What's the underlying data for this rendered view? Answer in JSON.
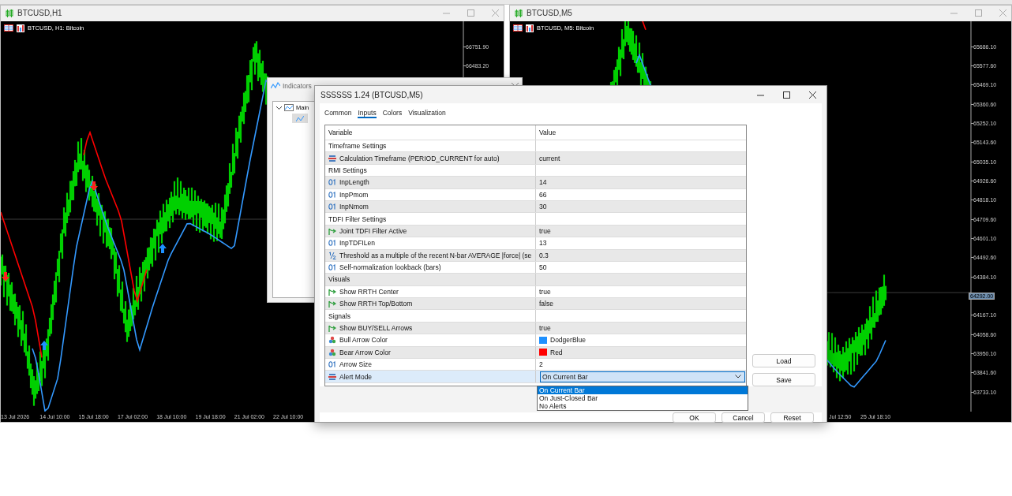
{
  "left_window": {
    "title": "BTCUSD,H1",
    "chart_label": "BTCUSD, H1:  Bitcoin",
    "price_axis": [
      {
        "kind": "tick",
        "label": "66751.90"
      },
      {
        "kind": "tick",
        "label": "66483.20"
      }
    ],
    "time_axis": [
      "13 Jul 2026",
      "14 Jul 10:00",
      "15 Jul 18:00",
      "17 Jul 02:00",
      "18 Jul 10:00",
      "19 Jul 18:00",
      "21 Jul 02:00",
      "22 Jul 10:00"
    ]
  },
  "right_window": {
    "title": "BTCUSD,M5",
    "chart_label": "BTCUSD, M5:  Bitcoin",
    "price_axis": [
      {
        "kind": "tick",
        "label": "65686.10"
      },
      {
        "kind": "tick",
        "label": "65577.60"
      },
      {
        "kind": "tick",
        "label": "65469.10"
      },
      {
        "kind": "tick",
        "label": "65360.60"
      },
      {
        "kind": "tick",
        "label": "65252.10"
      },
      {
        "kind": "tick",
        "label": "65143.60"
      },
      {
        "kind": "tick",
        "label": "65035.10"
      },
      {
        "kind": "tick",
        "label": "64926.60"
      },
      {
        "kind": "tick",
        "label": "64818.10"
      },
      {
        "kind": "tick",
        "label": "64709.60"
      },
      {
        "kind": "tick",
        "label": "64601.10"
      },
      {
        "kind": "tick",
        "label": "64492.60"
      },
      {
        "kind": "tick",
        "label": "64384.10"
      },
      {
        "kind": "current",
        "label": "64292.00"
      },
      {
        "kind": "tick",
        "label": "64167.10"
      },
      {
        "kind": "tick",
        "label": "64058.60"
      },
      {
        "kind": "tick",
        "label": "63950.10"
      },
      {
        "kind": "tick",
        "label": "63841.60"
      },
      {
        "kind": "tick",
        "label": "63733.10"
      }
    ],
    "time_axis": [
      "Jul 12:50",
      "25 Jul 18:10"
    ]
  },
  "indicators_window": {
    "title": "Indicators",
    "tree": [
      {
        "label": "Main",
        "expanded": true
      }
    ]
  },
  "dialog": {
    "title": "SSSSSS 1.24 (BTCUSD,M5)",
    "tabs": [
      {
        "label": "Common",
        "selected": false
      },
      {
        "label": "Inputs",
        "selected": true
      },
      {
        "label": "Colors",
        "selected": false
      },
      {
        "label": "Visualization",
        "selected": false
      }
    ],
    "columns": [
      "Variable",
      "Value"
    ],
    "rows": [
      {
        "kind": "group",
        "variable": "Timeframe Settings"
      },
      {
        "kind": "enum",
        "variable": "Calculation Timeframe (PERIOD_CURRENT for auto)",
        "value": "current",
        "selected": false
      },
      {
        "kind": "group",
        "variable": "RMI Settings"
      },
      {
        "kind": "int",
        "variable": "InpLength",
        "value": "14",
        "selected": false
      },
      {
        "kind": "int",
        "variable": "InpPmom",
        "value": "66",
        "selected": false
      },
      {
        "kind": "int",
        "variable": "InpNmom",
        "value": "30",
        "selected": false
      },
      {
        "kind": "group",
        "variable": "TDFI Filter Settings"
      },
      {
        "kind": "bool",
        "variable": "Joint TDFI Filter Active",
        "value": "true",
        "selected": false
      },
      {
        "kind": "int",
        "variable": "InpTDFILen",
        "value": "13",
        "selected": false
      },
      {
        "kind": "double",
        "variable": "Threshold as a multiple of the recent N-bar AVERAGE |force| (se",
        "value": "0.3",
        "selected": false
      },
      {
        "kind": "int",
        "variable": "Self-normalization lookback (bars)",
        "value": "50",
        "selected": false
      },
      {
        "kind": "group",
        "variable": "Visuals"
      },
      {
        "kind": "bool",
        "variable": "Show RRTH Center",
        "value": "true",
        "selected": false
      },
      {
        "kind": "bool",
        "variable": "Show RRTH Top/Bottom",
        "value": "false",
        "selected": false
      },
      {
        "kind": "group",
        "variable": "Signals"
      },
      {
        "kind": "bool",
        "variable": "Show BUY/SELL Arrows",
        "value": "true",
        "selected": false
      },
      {
        "kind": "color",
        "variable": "Bull Arrow Color",
        "value": "DodgerBlue",
        "color": "#1e90ff",
        "selected": false
      },
      {
        "kind": "color",
        "variable": "Bear Arrow Color",
        "value": "Red",
        "color": "#ff0000",
        "selected": false
      },
      {
        "kind": "int",
        "variable": "Arrow Size",
        "value": "2",
        "selected": false
      },
      {
        "kind": "enum",
        "variable": "Alert Mode",
        "value": "On Current Bar",
        "selected": true,
        "options": [
          {
            "label": "On Current Bar",
            "selected": true
          },
          {
            "label": "On Just-Closed Bar",
            "selected": false
          },
          {
            "label": "No Alerts",
            "selected": false
          }
        ]
      }
    ],
    "side_buttons": [
      "Load",
      "Save"
    ],
    "buttons": [
      "OK",
      "Cancel",
      "Reset"
    ]
  }
}
